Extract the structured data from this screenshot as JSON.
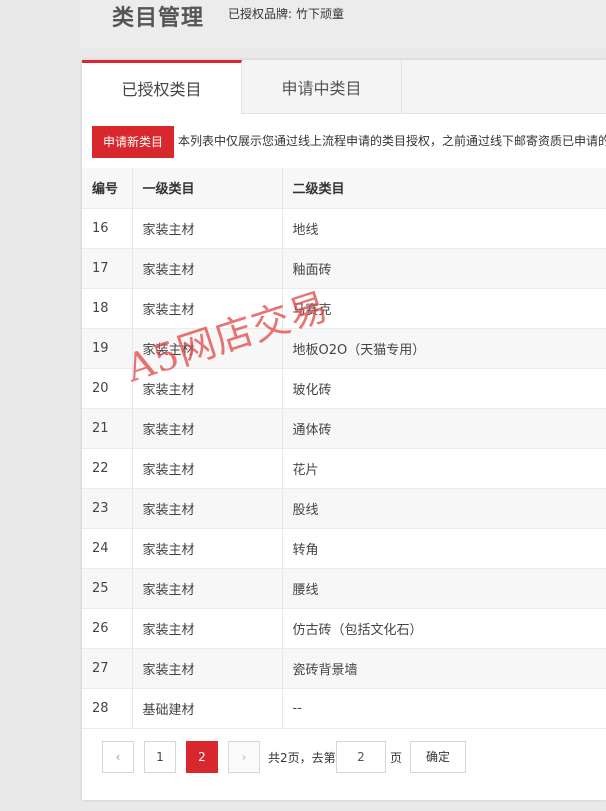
{
  "header": {
    "title": "类目管理",
    "brand_label": "已授权品牌:",
    "brand_value": "竹下顽童"
  },
  "tabs": [
    {
      "label": "已授权类目",
      "active": true
    },
    {
      "label": "申请中类目",
      "active": false
    }
  ],
  "actions": {
    "apply_label": "申请新类目",
    "notice": "本列表中仅展示您通过线上流程申请的类目授权，之前通过线下邮寄资质已申请的"
  },
  "table": {
    "columns": [
      "编号",
      "一级类目",
      "二级类目"
    ],
    "rows": [
      [
        "16",
        "家装主材",
        "地线"
      ],
      [
        "17",
        "家装主材",
        "釉面砖"
      ],
      [
        "18",
        "家装主材",
        "马赛克"
      ],
      [
        "19",
        "家装主材",
        "地板O2O（天猫专用）"
      ],
      [
        "20",
        "家装主材",
        "玻化砖"
      ],
      [
        "21",
        "家装主材",
        "通体砖"
      ],
      [
        "22",
        "家装主材",
        "花片"
      ],
      [
        "23",
        "家装主材",
        "股线"
      ],
      [
        "24",
        "家装主材",
        "转角"
      ],
      [
        "25",
        "家装主材",
        "腰线"
      ],
      [
        "26",
        "家装主材",
        "仿古砖（包括文化石）"
      ],
      [
        "27",
        "家装主材",
        "瓷砖背景墙"
      ],
      [
        "28",
        "基础建材",
        "--"
      ]
    ]
  },
  "watermark": "A5网店交易",
  "pager": {
    "prev_icon": "chevron-left-icon",
    "next_icon": "chevron-right-icon",
    "prev_glyph": "‹",
    "next_glyph": "›",
    "pages": [
      "1",
      "2"
    ],
    "current": "2",
    "total_text": "共2页，去第",
    "goto_value": "2",
    "unit_text": "页",
    "confirm_label": "确定"
  },
  "colors": {
    "accent": "#d8282e",
    "background": "#e9e9e9",
    "watermark": "#e24646"
  }
}
